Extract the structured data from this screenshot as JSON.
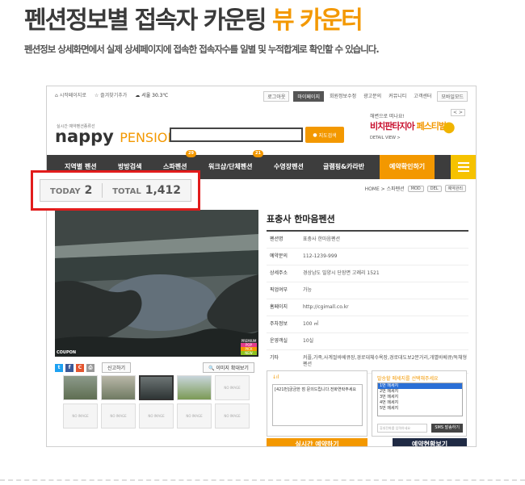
{
  "hero": {
    "title_main": "펜션정보별 접속자 카운팅 ",
    "title_accent": "뷰 카운터",
    "subtitle": "펜션정보 상세화면에서 실제 상세페이지에 접속한 접속자수를 일별 및 누적합계로 확인할 수 있습니다."
  },
  "site": {
    "toplinks": [
      "시작페이지로",
      "즐겨찾기추가"
    ],
    "weather": "서울 30.3℃",
    "util": [
      "로그아웃",
      "마이페이지",
      "회원정보수정",
      "광고문의",
      "커뮤니티",
      "고객센터",
      "모바일모드"
    ],
    "logo_small": "실시간 예약펜션종류선",
    "logo_word": "nappy",
    "logo_accent": "PENSION",
    "search_btn": "지도검색",
    "ad": {
      "l1": "해변으로 떠나요!",
      "l2a": "비치판타지아 ",
      "l2b": "페스티벌",
      "l3": "DETAIL VIEW >",
      "arrows": "< >"
    }
  },
  "nav": {
    "items": [
      {
        "label": "지역별 펜션",
        "badge": ""
      },
      {
        "label": "방방검색",
        "badge": ""
      },
      {
        "label": "스파펜션",
        "badge": "29"
      },
      {
        "label": "워크샵/단체펜션",
        "badge": "21"
      },
      {
        "label": "수영장펜션",
        "badge": ""
      },
      {
        "label": "글램핑&카라반",
        "badge": ""
      },
      {
        "label": "예약확인하기",
        "badge": ""
      }
    ]
  },
  "breadcrumb": {
    "path": "HOME > 스파펜션",
    "b1": "MOD",
    "b2": "DEL",
    "b3": "예약관리"
  },
  "pension": {
    "name": "표충사 한마음펜션",
    "coupon": "COUPON",
    "flags": [
      "PREMIUM",
      "POP",
      "PICK",
      "NEW"
    ],
    "rows": [
      {
        "k": "펜션명",
        "v": "표충사 한마음펜션"
      },
      {
        "k": "예약문의",
        "v": "112-1239-999"
      },
      {
        "k": "상세주소",
        "v": "경상남도 밀양시 단장면 고례리 1521"
      },
      {
        "k": "픽업여부",
        "v": "가능"
      },
      {
        "k": "홈페이지",
        "v": "http://cgimall.co.kr"
      },
      {
        "k": "주차정보",
        "v": "100 ㎡"
      },
      {
        "k": "운영객실",
        "v": "10실"
      },
      {
        "k": "기타",
        "v": "커플,가족,사계절바베큐장,경로대체수욕장,경로대도보2분거리,개별바베큐/독채형펜션"
      }
    ]
  },
  "share": {
    "report": "신고하기",
    "enlarge": "이미지 확대보기"
  },
  "thumbs": [
    "",
    "",
    "",
    "",
    "NO IMAGE",
    "NO IMAGE",
    "NO IMAGE",
    "NO IMAGE",
    "NO IMAGE",
    "NO IMAGE"
  ],
  "message": {
    "signal": "↓ıl",
    "text": "[421번]궁금한 점 문의드립니다.전화연락주세요",
    "header": "발송할 메세지를 선택해주세요",
    "options": [
      "1번 메세지",
      "2번 메세지",
      "3번 메세지",
      "4번 메세지",
      "5번 메세지"
    ],
    "phone_placeholder": "휴대전화를 입력하세요",
    "send": "SMS 발송하기"
  },
  "bottom": {
    "btn1": "실시간 예약하기",
    "btn2": "예약현황보기"
  },
  "counter": {
    "today_label": "TODAY",
    "today_value": "2",
    "total_label": "TOTAL",
    "total_value": "1,412"
  },
  "colors": {
    "accent": "#f39800",
    "highlight": "#e21c1c",
    "nav": "#3d3d3d"
  }
}
